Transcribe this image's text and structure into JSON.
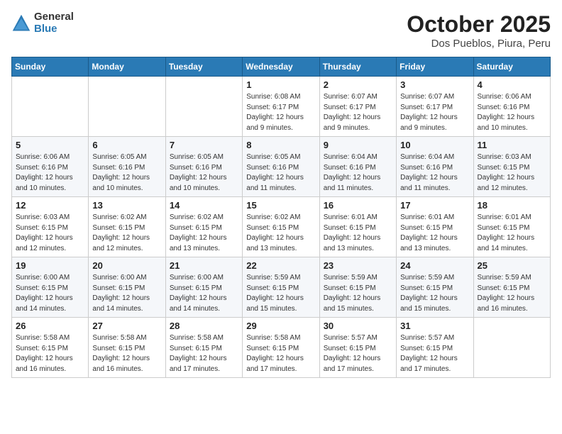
{
  "header": {
    "logo_line1": "General",
    "logo_line2": "Blue",
    "month": "October 2025",
    "location": "Dos Pueblos, Piura, Peru"
  },
  "weekdays": [
    "Sunday",
    "Monday",
    "Tuesday",
    "Wednesday",
    "Thursday",
    "Friday",
    "Saturday"
  ],
  "weeks": [
    [
      {
        "day": "",
        "info": ""
      },
      {
        "day": "",
        "info": ""
      },
      {
        "day": "",
        "info": ""
      },
      {
        "day": "1",
        "info": "Sunrise: 6:08 AM\nSunset: 6:17 PM\nDaylight: 12 hours and 9 minutes."
      },
      {
        "day": "2",
        "info": "Sunrise: 6:07 AM\nSunset: 6:17 PM\nDaylight: 12 hours and 9 minutes."
      },
      {
        "day": "3",
        "info": "Sunrise: 6:07 AM\nSunset: 6:17 PM\nDaylight: 12 hours and 9 minutes."
      },
      {
        "day": "4",
        "info": "Sunrise: 6:06 AM\nSunset: 6:16 PM\nDaylight: 12 hours and 10 minutes."
      }
    ],
    [
      {
        "day": "5",
        "info": "Sunrise: 6:06 AM\nSunset: 6:16 PM\nDaylight: 12 hours and 10 minutes."
      },
      {
        "day": "6",
        "info": "Sunrise: 6:05 AM\nSunset: 6:16 PM\nDaylight: 12 hours and 10 minutes."
      },
      {
        "day": "7",
        "info": "Sunrise: 6:05 AM\nSunset: 6:16 PM\nDaylight: 12 hours and 10 minutes."
      },
      {
        "day": "8",
        "info": "Sunrise: 6:05 AM\nSunset: 6:16 PM\nDaylight: 12 hours and 11 minutes."
      },
      {
        "day": "9",
        "info": "Sunrise: 6:04 AM\nSunset: 6:16 PM\nDaylight: 12 hours and 11 minutes."
      },
      {
        "day": "10",
        "info": "Sunrise: 6:04 AM\nSunset: 6:16 PM\nDaylight: 12 hours and 11 minutes."
      },
      {
        "day": "11",
        "info": "Sunrise: 6:03 AM\nSunset: 6:15 PM\nDaylight: 12 hours and 12 minutes."
      }
    ],
    [
      {
        "day": "12",
        "info": "Sunrise: 6:03 AM\nSunset: 6:15 PM\nDaylight: 12 hours and 12 minutes."
      },
      {
        "day": "13",
        "info": "Sunrise: 6:02 AM\nSunset: 6:15 PM\nDaylight: 12 hours and 12 minutes."
      },
      {
        "day": "14",
        "info": "Sunrise: 6:02 AM\nSunset: 6:15 PM\nDaylight: 12 hours and 13 minutes."
      },
      {
        "day": "15",
        "info": "Sunrise: 6:02 AM\nSunset: 6:15 PM\nDaylight: 12 hours and 13 minutes."
      },
      {
        "day": "16",
        "info": "Sunrise: 6:01 AM\nSunset: 6:15 PM\nDaylight: 12 hours and 13 minutes."
      },
      {
        "day": "17",
        "info": "Sunrise: 6:01 AM\nSunset: 6:15 PM\nDaylight: 12 hours and 13 minutes."
      },
      {
        "day": "18",
        "info": "Sunrise: 6:01 AM\nSunset: 6:15 PM\nDaylight: 12 hours and 14 minutes."
      }
    ],
    [
      {
        "day": "19",
        "info": "Sunrise: 6:00 AM\nSunset: 6:15 PM\nDaylight: 12 hours and 14 minutes."
      },
      {
        "day": "20",
        "info": "Sunrise: 6:00 AM\nSunset: 6:15 PM\nDaylight: 12 hours and 14 minutes."
      },
      {
        "day": "21",
        "info": "Sunrise: 6:00 AM\nSunset: 6:15 PM\nDaylight: 12 hours and 14 minutes."
      },
      {
        "day": "22",
        "info": "Sunrise: 5:59 AM\nSunset: 6:15 PM\nDaylight: 12 hours and 15 minutes."
      },
      {
        "day": "23",
        "info": "Sunrise: 5:59 AM\nSunset: 6:15 PM\nDaylight: 12 hours and 15 minutes."
      },
      {
        "day": "24",
        "info": "Sunrise: 5:59 AM\nSunset: 6:15 PM\nDaylight: 12 hours and 15 minutes."
      },
      {
        "day": "25",
        "info": "Sunrise: 5:59 AM\nSunset: 6:15 PM\nDaylight: 12 hours and 16 minutes."
      }
    ],
    [
      {
        "day": "26",
        "info": "Sunrise: 5:58 AM\nSunset: 6:15 PM\nDaylight: 12 hours and 16 minutes."
      },
      {
        "day": "27",
        "info": "Sunrise: 5:58 AM\nSunset: 6:15 PM\nDaylight: 12 hours and 16 minutes."
      },
      {
        "day": "28",
        "info": "Sunrise: 5:58 AM\nSunset: 6:15 PM\nDaylight: 12 hours and 17 minutes."
      },
      {
        "day": "29",
        "info": "Sunrise: 5:58 AM\nSunset: 6:15 PM\nDaylight: 12 hours and 17 minutes."
      },
      {
        "day": "30",
        "info": "Sunrise: 5:57 AM\nSunset: 6:15 PM\nDaylight: 12 hours and 17 minutes."
      },
      {
        "day": "31",
        "info": "Sunrise: 5:57 AM\nSunset: 6:15 PM\nDaylight: 12 hours and 17 minutes."
      },
      {
        "day": "",
        "info": ""
      }
    ]
  ]
}
